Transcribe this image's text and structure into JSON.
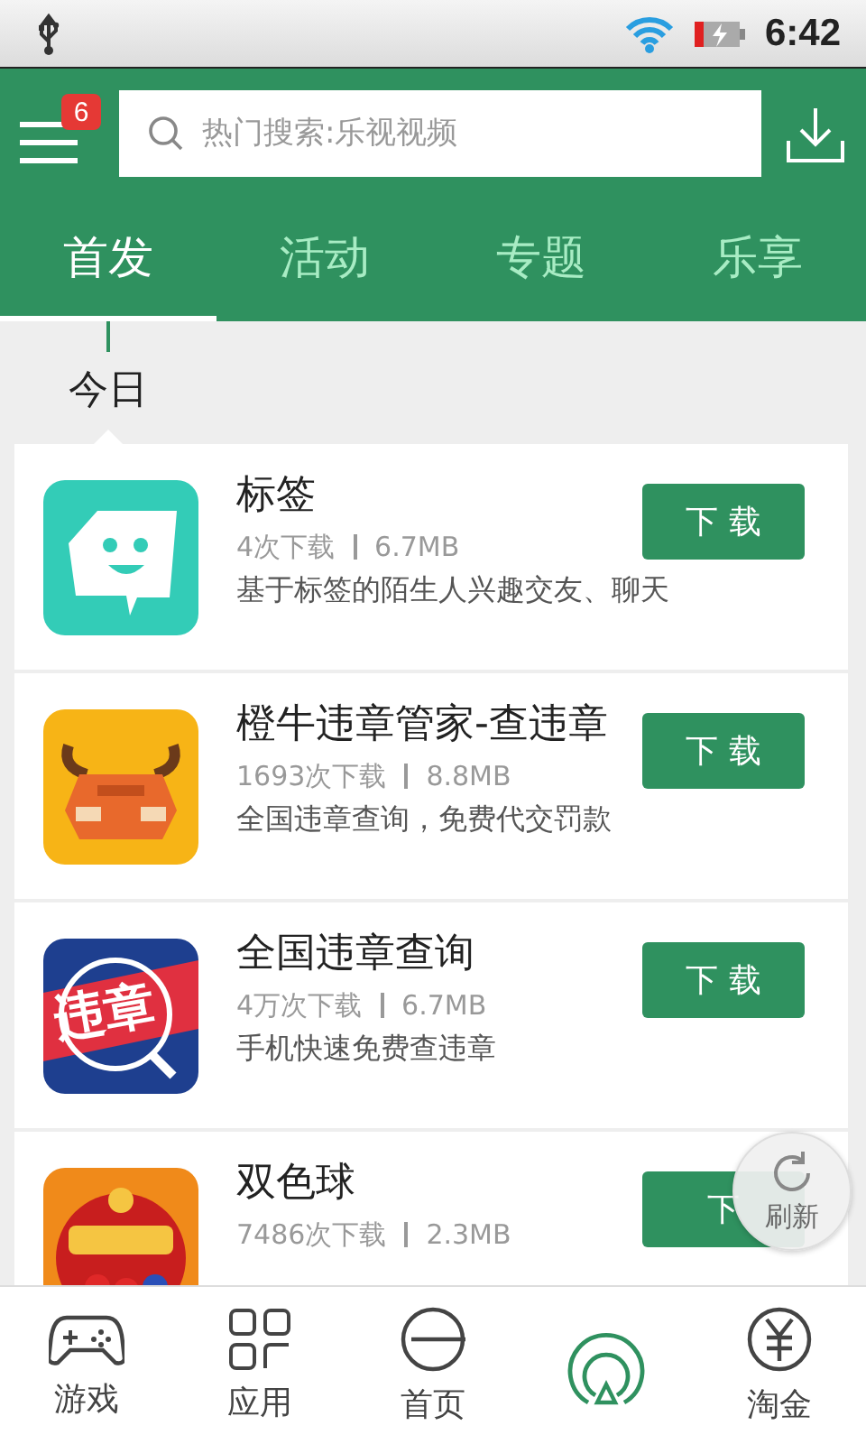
{
  "status_bar": {
    "time": "6:42"
  },
  "header": {
    "badge": "6",
    "search": {
      "placeholder": "热门搜索:乐视视频"
    }
  },
  "tabs": [
    {
      "label": "首发",
      "selected": true
    },
    {
      "label": "活动",
      "selected": false
    },
    {
      "label": "专题",
      "selected": false
    },
    {
      "label": "乐享",
      "selected": false
    }
  ],
  "section": {
    "title": "今日"
  },
  "apps": [
    {
      "kind": "tag",
      "name": "标签",
      "downloads": "4次下载",
      "size": "6.7MB",
      "description": "基于标签的陌生人兴趣交友、聊天",
      "button": "下 载"
    },
    {
      "kind": "bull",
      "name": "橙牛违章管家-查违章",
      "downloads": "1693次下载",
      "size": "8.8MB",
      "description": "全国违章查询，免费代交罚款",
      "button": "下 载"
    },
    {
      "kind": "violation",
      "icon_text": "违章",
      "name": "全国违章查询",
      "downloads": "4万次下载",
      "size": "6.7MB",
      "description": "手机快速免费查违章",
      "button": "下 载"
    },
    {
      "kind": "lottery",
      "name": "双色球",
      "downloads": "7486次下载",
      "size": "2.3MB",
      "button": "下"
    }
  ],
  "refresh": {
    "label": "刷新"
  },
  "nav": [
    {
      "kind": "gamepad",
      "label": "游戏"
    },
    {
      "kind": "grid",
      "label": "应用"
    },
    {
      "kind": "home",
      "label": "首页"
    },
    {
      "kind": "radar"
    },
    {
      "kind": "coin",
      "label": "淘金"
    }
  ]
}
